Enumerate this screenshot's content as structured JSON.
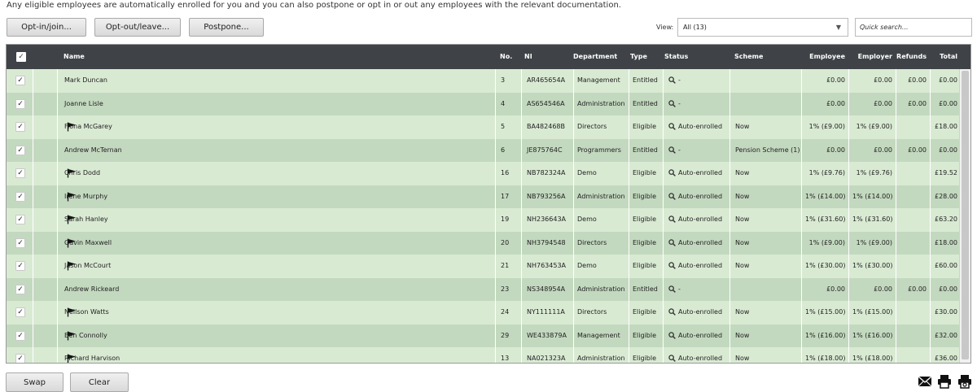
{
  "notice": "Any eligible employees are automatically enrolled for you and you can also postpone or opt in or out any employees with the relevant documentation.",
  "toolbar": {
    "opt_in": "Opt-in/join...",
    "opt_out": "Opt-out/leave...",
    "postpone": "Postpone..."
  },
  "view": {
    "label": "View:",
    "selected": "All (13)"
  },
  "search": {
    "placeholder": "Quick search..."
  },
  "columns": {
    "name": "Name",
    "no": "No.",
    "ni": "NI",
    "department": "Department",
    "type": "Type",
    "status": "Status",
    "scheme": "Scheme",
    "employee": "Employee",
    "employer": "Employer",
    "refunds": "Refunds",
    "total": "Total"
  },
  "rows": [
    {
      "checked": true,
      "flag": false,
      "name": "Mark Duncan",
      "no": "3",
      "ni": "AR465654A",
      "department": "Management",
      "type": "Entitled",
      "status": "-",
      "scheme": "",
      "employee": "£0.00",
      "employer": "£0.00",
      "refunds": "£0.00",
      "total": "£0.00"
    },
    {
      "checked": true,
      "flag": false,
      "name": "Joanne Lisle",
      "no": "4",
      "ni": "AS654546A",
      "department": "Administration",
      "type": "Entitled",
      "status": "-",
      "scheme": "",
      "employee": "£0.00",
      "employer": "£0.00",
      "refunds": "£0.00",
      "total": "£0.00"
    },
    {
      "checked": true,
      "flag": true,
      "name": "Fiona McGarey",
      "no": "5",
      "ni": "BA482468B",
      "department": "Directors",
      "type": "Eligible",
      "status": "Auto-enrolled",
      "scheme": "Now",
      "employee": "1% (£9.00)",
      "employer": "1% (£9.00)",
      "refunds": "",
      "total": "£18.00"
    },
    {
      "checked": true,
      "flag": false,
      "name": "Andrew McTernan",
      "no": "6",
      "ni": "JE875764C",
      "department": "Programmers",
      "type": "Entitled",
      "status": "-",
      "scheme": "Pension Scheme (1)",
      "employee": "£0.00",
      "employer": "£0.00",
      "refunds": "£0.00",
      "total": "£0.00"
    },
    {
      "checked": true,
      "flag": true,
      "name": "Chris Dodd",
      "no": "16",
      "ni": "NB782324A",
      "department": "Demo",
      "type": "Eligible",
      "status": "Auto-enrolled",
      "scheme": "Now",
      "employee": "1% (£9.76)",
      "employer": "1% (£9.76)",
      "refunds": "",
      "total": "£19.52"
    },
    {
      "checked": true,
      "flag": true,
      "name": "Irene Murphy",
      "no": "17",
      "ni": "NB793256A",
      "department": "Administration",
      "type": "Eligible",
      "status": "Auto-enrolled",
      "scheme": "Now",
      "employee": "1% (£14.00)",
      "employer": "1% (£14.00)",
      "refunds": "",
      "total": "£28.00"
    },
    {
      "checked": true,
      "flag": true,
      "name": "Sarah Hanley",
      "no": "19",
      "ni": "NH236643A",
      "department": "Demo",
      "type": "Eligible",
      "status": "Auto-enrolled",
      "scheme": "Now",
      "employee": "1% (£31.60)",
      "employer": "1% (£31.60)",
      "refunds": "",
      "total": "£63.20"
    },
    {
      "checked": true,
      "flag": true,
      "name": "Gavin Maxwell",
      "no": "20",
      "ni": "NH3794548",
      "department": "Directors",
      "type": "Eligible",
      "status": "Auto-enrolled",
      "scheme": "Now",
      "employee": "1% (£9.00)",
      "employer": "1% (£9.00)",
      "refunds": "",
      "total": "£18.00"
    },
    {
      "checked": true,
      "flag": true,
      "name": "Jason McCourt",
      "no": "21",
      "ni": "NH763453A",
      "department": "Demo",
      "type": "Eligible",
      "status": "Auto-enrolled",
      "scheme": "Now",
      "employee": "1% (£30.00)",
      "employer": "1% (£30.00)",
      "refunds": "",
      "total": "£60.00"
    },
    {
      "checked": true,
      "flag": false,
      "name": "Andrew Rickeard",
      "no": "23",
      "ni": "NS348954A",
      "department": "Administration",
      "type": "Entitled",
      "status": "-",
      "scheme": "",
      "employee": "£0.00",
      "employer": "£0.00",
      "refunds": "£0.00",
      "total": "£0.00"
    },
    {
      "checked": true,
      "flag": true,
      "name": "Neilson Watts",
      "no": "24",
      "ni": "NY111111A",
      "department": "Directors",
      "type": "Eligible",
      "status": "Auto-enrolled",
      "scheme": "Now",
      "employee": "1% (£15.00)",
      "employer": "1% (£15.00)",
      "refunds": "",
      "total": "£30.00"
    },
    {
      "checked": true,
      "flag": true,
      "name": "Ben Connolly",
      "no": "29",
      "ni": "WE433879A",
      "department": "Management",
      "type": "Eligible",
      "status": "Auto-enrolled",
      "scheme": "Now",
      "employee": "1% (£16.00)",
      "employer": "1% (£16.00)",
      "refunds": "",
      "total": "£32.00"
    },
    {
      "checked": true,
      "flag": true,
      "name": "Richard Harvison",
      "no": "13",
      "ni": "NA021323A",
      "department": "Administration",
      "type": "Eligible",
      "status": "Auto-enrolled",
      "scheme": "Now",
      "employee": "1% (£18.00)",
      "employer": "1% (£18.00)",
      "refunds": "",
      "total": "£36.00"
    }
  ],
  "footer": {
    "swap": "Swap",
    "clear": "Clear"
  },
  "icons": {
    "email": "email-icon",
    "print": "printer-icon",
    "print_preview": "print-preview-icon"
  },
  "colors": {
    "header_bg": "#3f4347",
    "row_light": "#d9ead3",
    "row_dark": "#c3d9bf"
  }
}
